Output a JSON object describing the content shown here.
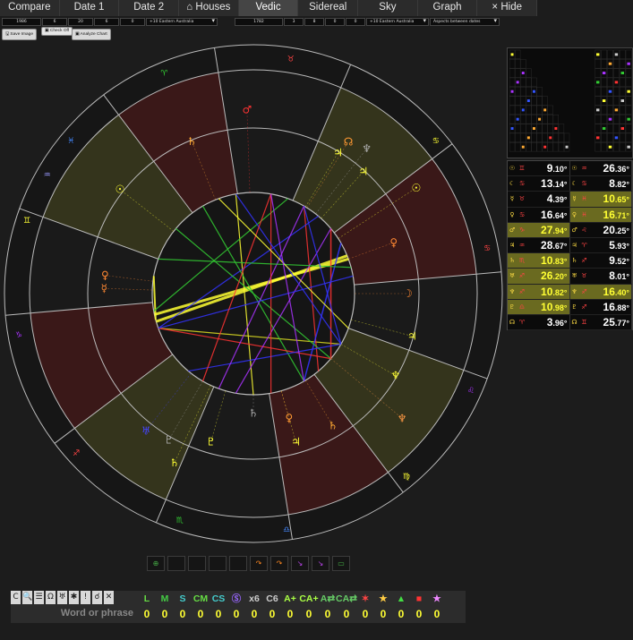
{
  "tabs": [
    {
      "label": "Compare",
      "active": false
    },
    {
      "label": "Date 1",
      "active": false
    },
    {
      "label": "Date 2",
      "active": false
    },
    {
      "label": "⌂ Houses",
      "active": false
    },
    {
      "label": "Vedic",
      "active": true
    },
    {
      "label": "Sidereal",
      "active": false
    },
    {
      "label": "Sky",
      "active": false
    },
    {
      "label": "Graph",
      "active": false
    },
    {
      "label": "× Hide",
      "active": false
    }
  ],
  "date1_inputs": {
    "year": "1986",
    "month": "6",
    "day": "20",
    "hour": "6",
    "minute": "0",
    "timezone": "+10 Eastern Australia"
  },
  "date2_inputs": {
    "year": "1782",
    "month": "3",
    "day": "8",
    "hour": "0",
    "minute": "0",
    "timezone": "+10 Eastern Australia",
    "aspects_mode": "Aspects between dates"
  },
  "buttons": {
    "save_image": "Save Image",
    "check_a": "Check",
    "check_b": "Off",
    "analyze": "Analyze Chart"
  },
  "planet_table": [
    [
      {
        "glyph": "☉",
        "sign": "♊",
        "deg": "9",
        "min": ".10°",
        "hl": false
      },
      {
        "glyph": "☉",
        "sign": "♒",
        "deg": "26",
        "min": ".36°",
        "hl": false
      }
    ],
    [
      {
        "glyph": "☾",
        "sign": "♋",
        "deg": "13",
        "min": ".14°",
        "hl": false
      },
      {
        "glyph": "☾",
        "sign": "♋",
        "deg": "8",
        "min": ".82°",
        "hl": false
      }
    ],
    [
      {
        "glyph": "☿",
        "sign": "♉",
        "deg": "4",
        "min": ".39°",
        "hl": false
      },
      {
        "glyph": "☿",
        "sign": "♓",
        "deg": "10",
        "min": ".65°",
        "hl": true
      }
    ],
    [
      {
        "glyph": "♀",
        "sign": "♋",
        "deg": "16",
        "min": ".64°",
        "hl": false
      },
      {
        "glyph": "♀",
        "sign": "♓",
        "deg": "16",
        "min": ".71°",
        "hl": true
      }
    ],
    [
      {
        "glyph": "♂",
        "sign": "♑",
        "deg": "27",
        "min": ".94°",
        "hl": true
      },
      {
        "glyph": "♂",
        "sign": "♌",
        "deg": "20",
        "min": ".25°",
        "hl": false
      }
    ],
    [
      {
        "glyph": "♃",
        "sign": "♒",
        "deg": "28",
        "min": ".67°",
        "hl": false
      },
      {
        "glyph": "♃",
        "sign": "♈",
        "deg": "5",
        "min": ".93°",
        "hl": false
      }
    ],
    [
      {
        "glyph": "♄",
        "sign": "♏",
        "deg": "10",
        "min": ".83°",
        "hl": true
      },
      {
        "glyph": "♄",
        "sign": "♐",
        "deg": "9",
        "min": ".52°",
        "hl": false
      }
    ],
    [
      {
        "glyph": "♅",
        "sign": "♐",
        "deg": "26",
        "min": ".20°",
        "hl": true
      },
      {
        "glyph": "♅",
        "sign": "♉",
        "deg": "8",
        "min": ".01°",
        "hl": false
      }
    ],
    [
      {
        "glyph": "♆",
        "sign": "♐",
        "deg": "10",
        "min": ".82°",
        "hl": true
      },
      {
        "glyph": "♆",
        "sign": "♐",
        "deg": "16",
        "min": ".40°",
        "hl": true
      }
    ],
    [
      {
        "glyph": "♇",
        "sign": "♎",
        "deg": "10",
        "min": ".98°",
        "hl": true
      },
      {
        "glyph": "♇",
        "sign": "♐",
        "deg": "16",
        "min": ".88°",
        "hl": false
      }
    ],
    [
      {
        "glyph": "☊",
        "sign": "♈",
        "deg": "3",
        "min": ".96°",
        "hl": false
      },
      {
        "glyph": "☊",
        "sign": "♊",
        "deg": "25",
        "min": ".77°",
        "hl": false
      }
    ]
  ],
  "search": {
    "placeholder": "Word or phrase",
    "icons": [
      "C",
      "🔍",
      "☰",
      "Ω",
      "♅",
      "✱",
      "!",
      "☌",
      "✕"
    ]
  },
  "filters": [
    {
      "label": "L",
      "value": "0",
      "color": "#66dd44"
    },
    {
      "label": "M",
      "value": "0",
      "color": "#44cc44"
    },
    {
      "label": "S",
      "value": "0",
      "color": "#44cccc"
    },
    {
      "label": "CM",
      "value": "0",
      "color": "#66dd44"
    },
    {
      "label": "CS",
      "value": "0",
      "color": "#44cccc"
    },
    {
      "label": "Ⓢ",
      "value": "0",
      "color": "#9966ff"
    },
    {
      "label": "x6",
      "value": "0",
      "color": "#cccccc"
    },
    {
      "label": "C6",
      "value": "0",
      "color": "#cccccc"
    },
    {
      "label": "A+",
      "value": "0",
      "color": "#aaff44"
    },
    {
      "label": "CA+",
      "value": "0",
      "color": "#aaff44"
    },
    {
      "label": "A⇄",
      "value": "0",
      "color": "#66cc66"
    },
    {
      "label": "CA⇄",
      "value": "0",
      "color": "#66cc66"
    },
    {
      "label": "✶",
      "value": "0",
      "color": "#ff4444"
    },
    {
      "label": "★",
      "value": "0",
      "color": "#ffcc44"
    },
    {
      "label": "▲",
      "value": "0",
      "color": "#44dd44"
    },
    {
      "label": "■",
      "value": "0",
      "color": "#ff3333"
    },
    {
      "label": "★",
      "value": "0",
      "color": "#ee88ff"
    }
  ],
  "nav_buttons": [
    "⊕",
    "",
    "",
    "",
    "",
    "↷",
    "↷",
    "↘",
    "↘",
    "▭"
  ],
  "nav_colors": [
    "#44aa44",
    "#666",
    "#666",
    "#666",
    "#666",
    "#ff8822",
    "#ff8822",
    "#bb44ee",
    "#bb44ee",
    "#44aa44"
  ],
  "colors": {
    "accent_yellow": "#ffff33",
    "highlight_bg": "#6a6a20",
    "tab_active": "#454545"
  },
  "wheel": {
    "house_cusps_deg": [
      5,
      37,
      67,
      99,
      127,
      160,
      185,
      217,
      247,
      279,
      307,
      340
    ],
    "house_shades": [
      "#3a1818",
      "#34341c",
      "#1a1a1a",
      "#3a1818",
      "#34341c",
      "#1a1a1a",
      "#3a1818",
      "#34341c",
      "#1a1a1a",
      "#3a1818",
      "#34341c",
      "#1a1a1a"
    ],
    "outer_glyphs": [
      {
        "ch": "♉",
        "ang": 81,
        "c": "#ff4444"
      },
      {
        "ch": "♈",
        "ang": 112,
        "c": "#33cc33"
      },
      {
        "ch": "♓",
        "ang": 140,
        "c": "#4488ff"
      },
      {
        "ch": "♒",
        "ang": 150,
        "c": "#9999ff"
      },
      {
        "ch": "♊",
        "ang": 162,
        "c": "#ffff33"
      },
      {
        "ch": "♑",
        "ang": 190,
        "c": "#aa33ff"
      },
      {
        "ch": "♐",
        "ang": 222,
        "c": "#ff4444"
      },
      {
        "ch": "♏",
        "ang": 252,
        "c": "#33cc33"
      },
      {
        "ch": "♎",
        "ang": 278,
        "c": "#4488ff"
      },
      {
        "ch": "♍",
        "ang": 310,
        "c": "#ffff33"
      },
      {
        "ch": "♌",
        "ang": 336,
        "c": "#aa33ff"
      },
      {
        "ch": "♋",
        "ang": 40,
        "c": "#ffff33"
      },
      {
        "ch": "♋",
        "ang": 11,
        "c": "#ff4444"
      }
    ],
    "planets": [
      {
        "ch": "♂",
        "ang": 92,
        "r": 0.74,
        "c": "#ff3333"
      },
      {
        "ch": "♄",
        "ang": 112,
        "r": 0.66,
        "c": "#ffaa33"
      },
      {
        "ch": "☊",
        "ang": 58,
        "r": 0.72,
        "c": "#ff9933"
      },
      {
        "ch": "♃",
        "ang": 59,
        "r": 0.66,
        "c": "#ffff33"
      },
      {
        "ch": "♆",
        "ang": 52,
        "r": 0.74,
        "c": "#aaaaaa"
      },
      {
        "ch": "♃",
        "ang": 48,
        "r": 0.66,
        "c": "#ffff33"
      },
      {
        "ch": "☉",
        "ang": 33,
        "r": 0.78,
        "c": "#ffff33"
      },
      {
        "ch": "♀",
        "ang": 20,
        "r": 0.6,
        "c": "#ff8833"
      },
      {
        "ch": "☉",
        "ang": 142,
        "r": 0.68,
        "c": "#ffff33"
      },
      {
        "ch": "♀",
        "ang": 173,
        "r": 0.6,
        "c": "#ff8833"
      },
      {
        "ch": "☿",
        "ang": 178,
        "r": 0.6,
        "c": "#ff8833"
      },
      {
        "ch": "☽",
        "ang": 0,
        "r": 0.62,
        "c": "#ff8833"
      },
      {
        "ch": "♃",
        "ang": 345,
        "r": 0.66,
        "c": "#ffff33"
      },
      {
        "ch": "♆",
        "ang": 330,
        "r": 0.66,
        "c": "#ffff33"
      },
      {
        "ch": "♆",
        "ang": 320,
        "r": 0.78,
        "c": "#ff9944"
      },
      {
        "ch": "♄",
        "ang": 301,
        "r": 0.62,
        "c": "#ffaa33"
      },
      {
        "ch": "♃",
        "ang": 286,
        "r": 0.62,
        "c": "#ffff33"
      },
      {
        "ch": "♄",
        "ang": 270,
        "r": 0.48,
        "c": "#aaaaaa"
      },
      {
        "ch": "♇",
        "ang": 254,
        "r": 0.62,
        "c": "#ffff33"
      },
      {
        "ch": "♇",
        "ang": 240,
        "r": 0.68,
        "c": "#aaaaaa"
      },
      {
        "ch": "♅",
        "ang": 232,
        "r": 0.7,
        "c": "#4444ff"
      },
      {
        "ch": "♀",
        "ang": 286,
        "r": 0.52,
        "c": "#ff9933"
      },
      {
        "ch": "♄",
        "ang": 245,
        "r": 0.75,
        "c": "#ffff33"
      }
    ],
    "aspect_lines": [
      [
        192,
        20,
        "#ffff33",
        3
      ],
      [
        196,
        22,
        "#ffff33",
        3
      ],
      [
        195,
        170,
        "#ffff33",
        2
      ],
      [
        270,
        100,
        "#ffff33",
        1.2
      ],
      [
        200,
        330,
        "#dddd22",
        1.2
      ],
      [
        40,
        320,
        "#ff3333",
        1.5
      ],
      [
        60,
        310,
        "#ff3333",
        1.2
      ],
      [
        30,
        300,
        "#3333ff",
        1.5
      ],
      [
        50,
        200,
        "#3333ff",
        1.2
      ],
      [
        70,
        190,
        "#33cc33",
        1.2
      ],
      [
        120,
        300,
        "#33cc33",
        1.2
      ],
      [
        140,
        320,
        "#33cc33",
        1.2
      ],
      [
        200,
        320,
        "#ff3333",
        1.2
      ],
      [
        230,
        330,
        "#3333ff",
        1.2
      ],
      [
        250,
        60,
        "#aa33ff",
        1.2
      ],
      [
        260,
        40,
        "#aa33ff",
        1.2
      ],
      [
        280,
        80,
        "#ff3333",
        1.2
      ],
      [
        100,
        330,
        "#3333ff",
        1.2
      ],
      [
        10,
        200,
        "#3333ff",
        1.2
      ],
      [
        15,
        160,
        "#33cc33",
        1.2
      ],
      [
        80,
        240,
        "#ff3333",
        1.2
      ],
      [
        110,
        340,
        "#ffff33",
        1.2
      ],
      [
        330,
        60,
        "#3333ff",
        1.2
      ],
      [
        300,
        80,
        "#aa33ff",
        1.2
      ]
    ]
  }
}
